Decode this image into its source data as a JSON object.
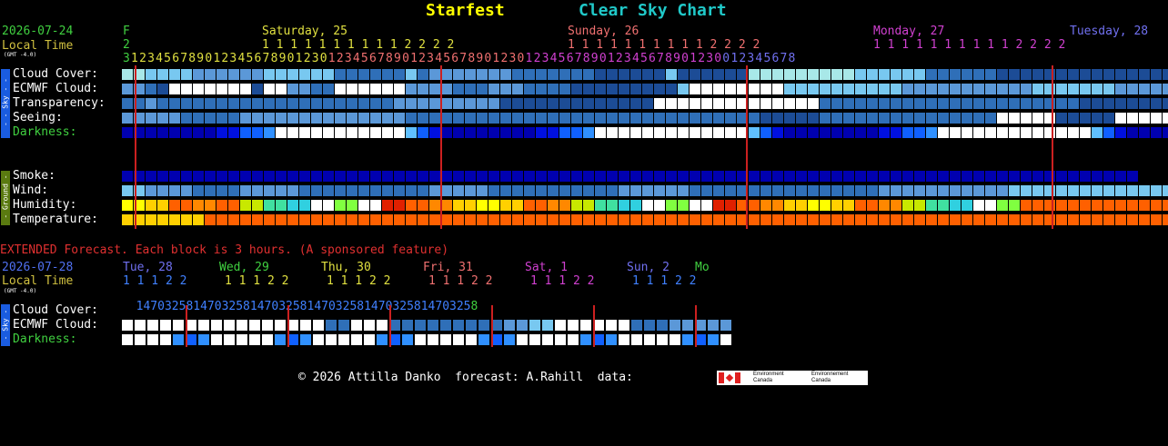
{
  "header": {
    "site": "Starfest",
    "title": "Clear Sky Chart",
    "site_color": "#ffff00",
    "title_color": "#20c8c8"
  },
  "hourly": {
    "date": "2026-07-24",
    "local_time": "Local Time",
    "gmt": "(GMT -4.0)",
    "first_day_letter": "F",
    "first_day_tens": "2",
    "first_hour": "3",
    "days": [
      {
        "label": "Saturday, 25",
        "color": "#e0e040"
      },
      {
        "label": "Sunday, 26",
        "color": "#f07070"
      },
      {
        "label": "Monday, 27",
        "color": "#d040d0"
      },
      {
        "label": "Tuesday, 28",
        "color": "#7070f0"
      }
    ],
    "tens_day": "1 1 1 1 1 1 1 1 1 1 2 2 2 2",
    "hours_day": "0123456789012345678901230",
    "hours_tail": "012345678",
    "labels": {
      "cloud": "Cloud Cover:",
      "ecmwf": "ECMWF Cloud:",
      "transparency": "Transparency:",
      "seeing": "Seeing:",
      "darkness": "Darkness:",
      "smoke": "Smoke:",
      "wind": "Wind:",
      "humidity": "Humidity:",
      "temperature": "Temperature:"
    },
    "sky_tag": "- - Sky - -",
    "ground_tag": "- Ground -",
    "rows": {
      "cloud": "AABBBBCCCCCCBBBBBBDDDDDDBDCCCCCCCDDDDDDDEEEEEEBEEEEEEAAAAAAAAABBBBBBDDDDDDEEEEEEEEEEEEEEEEEEEDDDDDDDDDDDDDDEEEEEEEEEEEE",
      "ecmwf": "CCDEWWWWWWWEWWCCDDWWWWWWCCCCDDDCCCDDDDEEEEEEEEEBWWWWWWWWBBBBBBBBBBCCCCCCCCCCCBBBBBBBCCCCCCCCCCCCCBBBBBBBBBBBBWWWWWWWWWWWWWWWW",
      "transparency": "DDCDDDDDDDDDDDDDDDDDDDDCCCCCCCCCEEEEEEEEEEEEEWWWWWWWWWWWWWWDDDDDDDDDDDDDDDDDDDDDDEEEEEEEEEEEWWWWWWWWWWWWWWWWWWWWWWWWWWWWWWWWW",
      "seeing": "CCCCCDDDDDCCCCCCCCCCCCCCDDDDDDDDDDDDDDDDDDDDDDDDDDDDDDEEEEEDDDDDDDDDDDDDDDWWWWWEEEEEWWWWWWWWDDDDDDGGGGGGWWWWWDDDDDDDDDDDDDDDDDD",
      "darkness": "KKKKKKKKLLMMNYYYYYYYYYYYOMLKKKKKKKKLLMMNYYYYYYYYYYYYYOMLKKKKKKKKLLMMNYYYYYYYYYYYYYOMLKKKKKKKKLLMMNYYYYYYYYYYYYYOMLKKKKKKKKLL",
      "smoke": "KKKKKKKKKKKKKKKKKKKKKKKKKKKKKKKKKKKKKKKKKKKKKKKKKKKKKKKKKKKKKKKKKKKKKKKKKKKKKKKKKKKKKK",
      "wind": "BBCCCCDDDDCCCCCDDDDDDDDDDDCCCCCDDDDDDDDDDDCCCCCCDDDDDDDDDDDDDDDDCCCCCCCCCCCBBBBBBBBBBBBBBBBBBBBBBBBBBBBCCCCCCCCCCCCCCBBBBBBBBBBBBB",
      "humidity": "PPQQRRSSRRTTUUVVWWXXYYZZRRSSQQPPQQRRSSTTUUVVWWXXYYZZRRSSQQPPQQRRSSTTUUVVWWXXRRRRRRRRRRRRRRRRRRRRRRRRRRRRRRRRRRRRRRRRRRRRR",
      "temperature": "QQQQQQQRRRRRRRRRRRRRRRRRRRRRRRRRRRRRRRRRRRRRRRRRRRRRRRRRRRRRRRRRRRRRRRRRRRRRRRRRRRRRRRRRRRRRRRRRRRRRRRRRRRRRRRRRRRRRRRR"
    }
  },
  "extended": {
    "note": "EXTENDED Forecast. Each block is 3 hours. (A sponsored feature)",
    "note_color": "#e03030",
    "date": "2026-07-28",
    "local_time": "Local Time",
    "gmt": "(GMT -4.0)",
    "days": [
      {
        "label": "Tue, 28",
        "color": "#7070f0"
      },
      {
        "label": "Wed, 29",
        "color": "#40d040"
      },
      {
        "label": "Thu, 30",
        "color": "#e0e040"
      },
      {
        "label": "Fri, 31",
        "color": "#f07070"
      },
      {
        "label": "Sat, 1",
        "color": "#d040d0"
      },
      {
        "label": "Sun, 2",
        "color": "#7070f0"
      },
      {
        "label": "Mo",
        "color": "#40d040"
      }
    ],
    "tens": "1 1 1 2 2",
    "hours": "14703258147032581470325814703258147032581470325",
    "hours_tail": "8",
    "labels": {
      "cloud": "Cloud Cover:",
      "ecmwf": "ECMWF Cloud:",
      "darkness": "Darkness:"
    },
    "sky_tag": "- Sky -",
    "rows": {
      "ecmwf": "WWWWWWWWWWWWWWWWDDWWWDDDDDDDDDCCBBWWWWWWDDDCCCCCDDD",
      "darkness": "WWWYNMNYWWWYNMNYWWWYNMNYWWWYNMNYWWWYNMNYWWWYNMNYWW"
    }
  },
  "footer": {
    "text": "© 2026 Attilla Danko  forecast: A.Rahill  data:",
    "logo_en": "Environment Canada",
    "logo_fr": "Environnement Canada"
  }
}
